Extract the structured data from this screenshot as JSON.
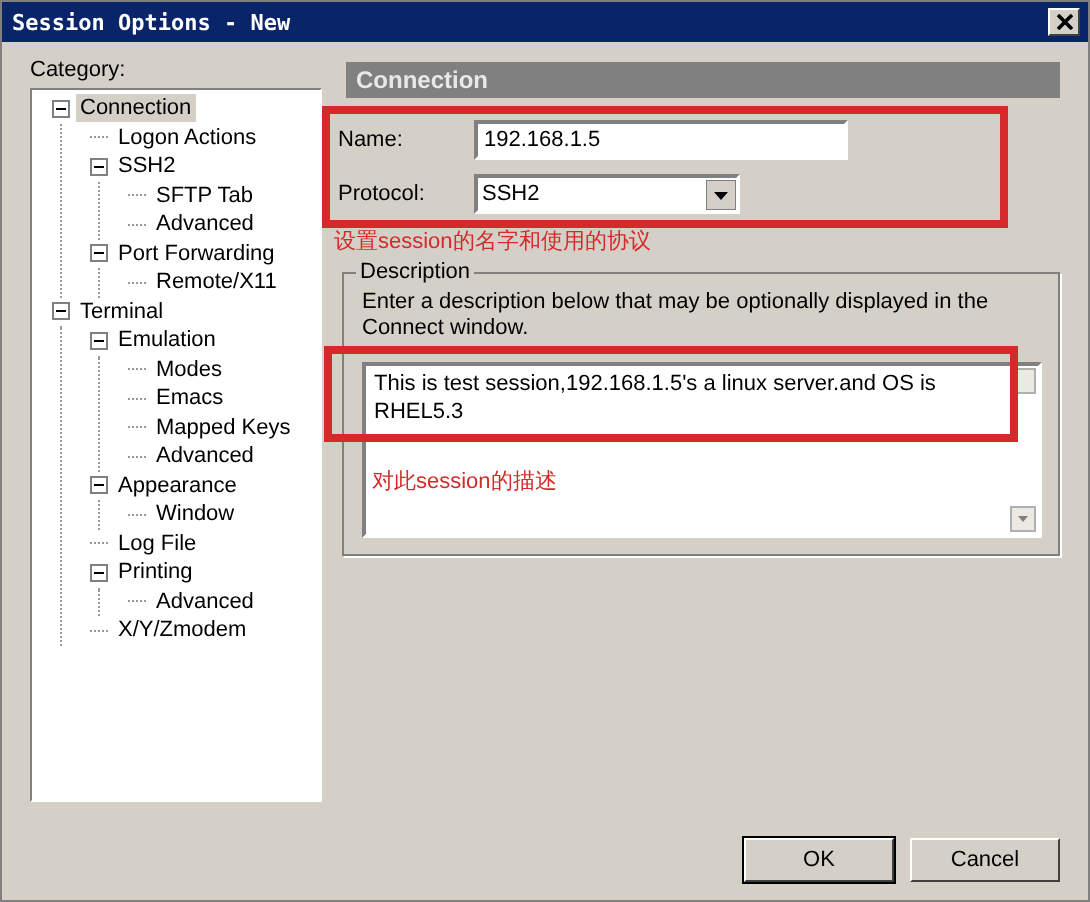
{
  "window": {
    "title": "Session Options - New"
  },
  "category_label": "Category:",
  "tree": [
    {
      "label": "Connection",
      "selected": true,
      "expanded": true,
      "children": [
        {
          "label": "Logon Actions",
          "selected": false
        },
        {
          "label": "SSH2",
          "selected": false,
          "expanded": true,
          "children": [
            {
              "label": "SFTP Tab",
              "selected": false
            },
            {
              "label": "Advanced",
              "selected": false
            }
          ]
        },
        {
          "label": "Port Forwarding",
          "selected": false,
          "expanded": true,
          "children": [
            {
              "label": "Remote/X11",
              "selected": false
            }
          ]
        }
      ]
    },
    {
      "label": "Terminal",
      "selected": false,
      "expanded": true,
      "children": [
        {
          "label": "Emulation",
          "selected": false,
          "expanded": true,
          "children": [
            {
              "label": "Modes",
              "selected": false
            },
            {
              "label": "Emacs",
              "selected": false
            },
            {
              "label": "Mapped Keys",
              "selected": false
            },
            {
              "label": "Advanced",
              "selected": false
            }
          ]
        },
        {
          "label": "Appearance",
          "selected": false,
          "expanded": true,
          "children": [
            {
              "label": "Window",
              "selected": false
            }
          ]
        },
        {
          "label": "Log File",
          "selected": false
        },
        {
          "label": "Printing",
          "selected": false,
          "expanded": true,
          "children": [
            {
              "label": "Advanced",
              "selected": false
            }
          ]
        },
        {
          "label": "X/Y/Zmodem",
          "selected": false
        }
      ]
    }
  ],
  "panel": {
    "header": "Connection",
    "name": {
      "label": "Name:",
      "value": "192.168.1.5"
    },
    "protocol": {
      "label": "Protocol:",
      "value": "SSH2"
    },
    "description": {
      "legend": "Description",
      "hint": "Enter a description below that may be optionally displayed in the Connect window.",
      "value": "This is test session,192.168.1.5's a linux server.and OS is RHEL5.3"
    }
  },
  "annotations": [
    {
      "text": "设置session的名字和使用的协议"
    },
    {
      "text": "对此session的描述"
    }
  ],
  "buttons": [
    "OK",
    "Cancel"
  ]
}
